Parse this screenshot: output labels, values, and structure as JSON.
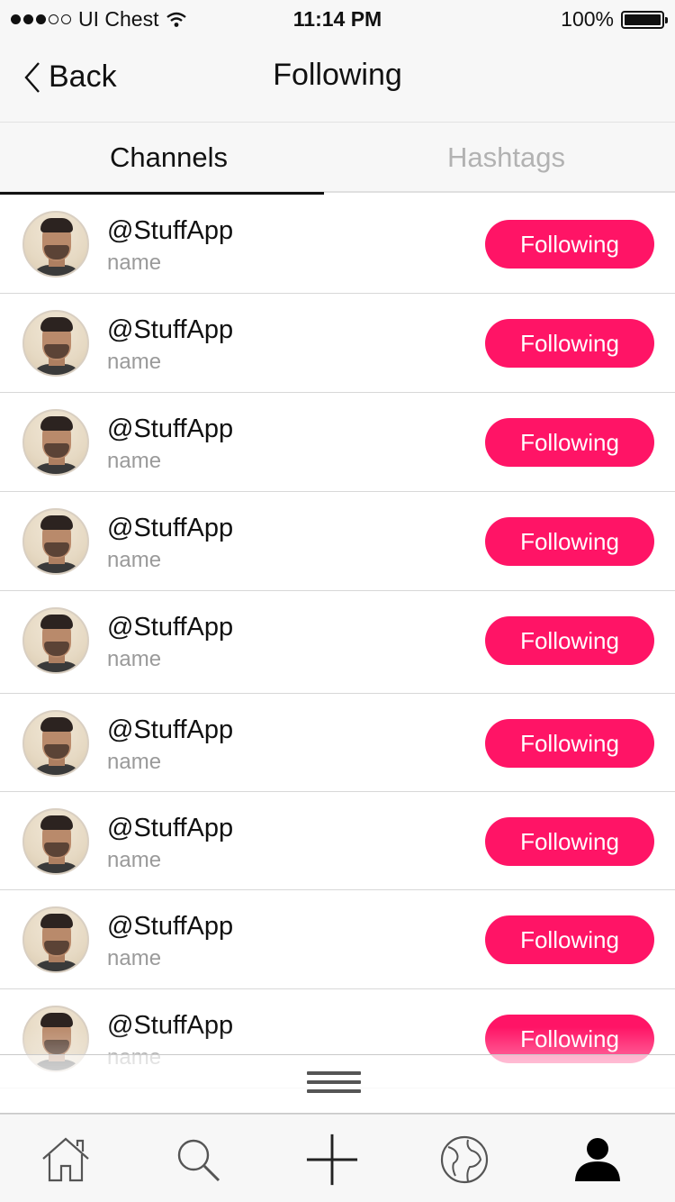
{
  "status_bar": {
    "carrier": "UI Chest",
    "time": "11:14 PM",
    "battery": "100%",
    "battery_level": 1.0,
    "signal_bars_filled": 3,
    "signal_bars_total": 5
  },
  "nav": {
    "back_label": "Back",
    "title": "Following"
  },
  "tabs": [
    {
      "label": "Channels",
      "active": true
    },
    {
      "label": "Hashtags",
      "active": false
    }
  ],
  "colors": {
    "accent": "#ff1466",
    "inactive_text": "#b2b2b2",
    "subtext": "#9a9a9a"
  },
  "channels": [
    {
      "handle": "@StuffApp",
      "name": "name",
      "button": "Following"
    },
    {
      "handle": "@StuffApp",
      "name": "name",
      "button": "Following"
    },
    {
      "handle": "@StuffApp",
      "name": "name",
      "button": "Following"
    },
    {
      "handle": "@StuffApp",
      "name": "name",
      "button": "Following"
    },
    {
      "handle": "@StuffApp",
      "name": "name",
      "button": "Following"
    },
    {
      "handle": "@StuffApp",
      "name": "name",
      "button": "Following"
    },
    {
      "handle": "@StuffApp",
      "name": "name",
      "button": "Following"
    },
    {
      "handle": "@StuffApp",
      "name": "name",
      "button": "Following"
    },
    {
      "handle": "@StuffApp",
      "name": "name",
      "button": "Following"
    }
  ],
  "tab_bar": {
    "items": [
      {
        "icon": "home-icon",
        "active": false
      },
      {
        "icon": "search-icon",
        "active": false
      },
      {
        "icon": "plus-icon",
        "active": false
      },
      {
        "icon": "globe-icon",
        "active": false
      },
      {
        "icon": "profile-icon",
        "active": true
      }
    ]
  }
}
